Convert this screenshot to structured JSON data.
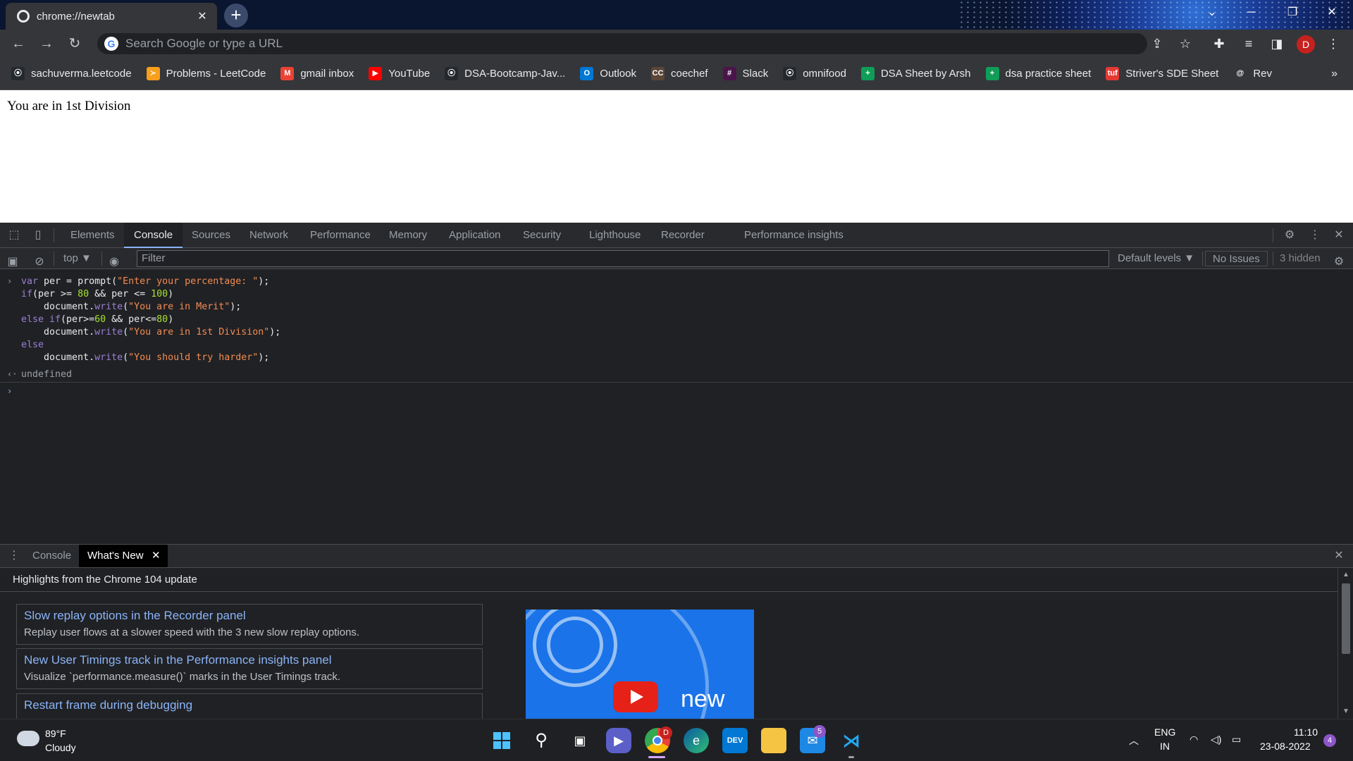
{
  "tab": {
    "title": "chrome://newtab",
    "close": "✕",
    "new_tab": "+"
  },
  "window": {
    "minimize": "─",
    "restore": "❐",
    "close": "✕",
    "tab_search": "⌄"
  },
  "toolbar": {
    "omnibox_placeholder": "Search Google or type a URL",
    "profile_initial": "D"
  },
  "bookmarks": [
    {
      "label": "sachuverma.leetcode",
      "icon": "github-icon",
      "color": "#24292e",
      "glyph": "⦿"
    },
    {
      "label": "Problems - LeetCode",
      "icon": "leetcode-icon",
      "color": "#f89f1b",
      "glyph": "≻"
    },
    {
      "label": "gmail inbox",
      "icon": "gmail-icon",
      "color": "#ea4335",
      "glyph": "M"
    },
    {
      "label": "YouTube",
      "icon": "youtube-icon",
      "color": "#ff0000",
      "glyph": "▶"
    },
    {
      "label": "DSA-Bootcamp-Jav...",
      "icon": "github-icon",
      "color": "#24292e",
      "glyph": "⦿"
    },
    {
      "label": "Outlook",
      "icon": "outlook-icon",
      "color": "#0078d4",
      "glyph": "O"
    },
    {
      "label": "coechef",
      "icon": "codechef-icon",
      "color": "#5b4638",
      "glyph": "CC"
    },
    {
      "label": "Slack",
      "icon": "slack-icon",
      "color": "#4a154b",
      "glyph": "#"
    },
    {
      "label": "omnifood",
      "icon": "github-icon",
      "color": "#24292e",
      "glyph": "⦿"
    },
    {
      "label": "DSA Sheet by Arsh",
      "icon": "sheets-icon",
      "color": "#0f9d58",
      "glyph": "+"
    },
    {
      "label": "dsa practice sheet",
      "icon": "sheets-icon",
      "color": "#0f9d58",
      "glyph": "+"
    },
    {
      "label": "Striver's SDE Sheet",
      "icon": "takeuforward-icon",
      "color": "#e53935",
      "glyph": "tuf"
    },
    {
      "label": "Rev",
      "icon": "rev-icon",
      "color": "#35363a",
      "glyph": "@"
    }
  ],
  "bookmarks_more": "»",
  "page": {
    "text": "You are in 1st Division"
  },
  "devtools": {
    "tabs": [
      "Elements",
      "Console",
      "Sources",
      "Network",
      "Performance",
      "Memory",
      "Application",
      "Security",
      "Lighthouse",
      "Recorder",
      "Performance insights"
    ],
    "active_tab": "Console",
    "context": "top ▼",
    "filter_placeholder": "Filter",
    "levels": "Default levels ▼",
    "issues": "No Issues",
    "hidden": "3 hidden"
  },
  "console": {
    "result": "undefined"
  },
  "drawer": {
    "tabs": [
      "Console",
      "What's New"
    ],
    "close_tab": "✕",
    "heading": "Highlights from the Chrome 104 update",
    "cards": [
      {
        "title": "Slow replay options in the Recorder panel",
        "desc": "Replay user flows at a slower speed with the 3 new slow replay options."
      },
      {
        "title": "New User Timings track in the Performance insights panel",
        "desc": "Visualize `performance.measure()` marks in the User Timings track."
      },
      {
        "title": "Restart frame during debugging",
        "desc": ""
      }
    ],
    "video_word": "new"
  },
  "taskbar": {
    "weather_temp": "89°F",
    "weather_desc": "Cloudy",
    "lang": "ENG",
    "region": "IN",
    "time": "11:10",
    "date": "23-08-2022",
    "notif_count": "4",
    "mail_badge": "5",
    "chrome_badge": "D"
  }
}
